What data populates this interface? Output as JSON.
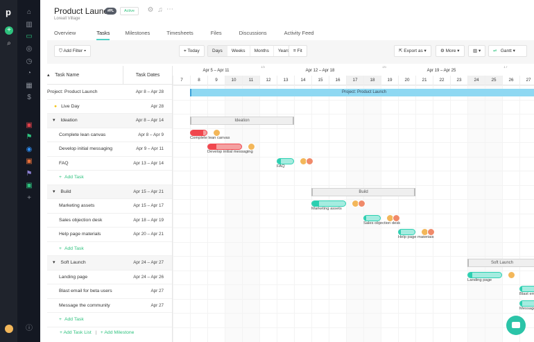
{
  "app": {
    "logo": "p"
  },
  "header": {
    "title": "Product Launch",
    "badge": "#PL",
    "status": "Active",
    "subtitle": "Loreall Village"
  },
  "tabs": [
    "Overview",
    "Tasks",
    "Milestones",
    "Timesheets",
    "Files",
    "Discussions",
    "Activity Feed"
  ],
  "toolbar": {
    "filter": "Add Filter",
    "today": "Today",
    "scales": [
      "Days",
      "Weeks",
      "Months",
      "Years"
    ],
    "fit": "Fit",
    "export": "Export as",
    "more": "More",
    "view": "Gantt"
  },
  "table": {
    "col_name": "Task Name",
    "col_dates": "Task Dates",
    "rows": [
      {
        "name": "Project: Product Launch",
        "dates": "Apr 8 – Apr 28",
        "type": "project"
      },
      {
        "name": "Live Day",
        "dates": "Apr 28",
        "type": "milestone"
      },
      {
        "name": "Ideation",
        "dates": "Apr 8 – Apr 14",
        "type": "group"
      },
      {
        "name": "Complete lean canvas",
        "dates": "Apr 8 – Apr 9",
        "type": "task"
      },
      {
        "name": "Develop initial messaging",
        "dates": "Apr 9 – Apr 11",
        "type": "task"
      },
      {
        "name": "FAQ",
        "dates": "Apr 13 – Apr 14",
        "type": "task"
      },
      {
        "name": "Add Task",
        "dates": "",
        "type": "add"
      },
      {
        "name": "Build",
        "dates": "Apr 15 – Apr 21",
        "type": "group"
      },
      {
        "name": "Marketing assets",
        "dates": "Apr 15 – Apr 17",
        "type": "task"
      },
      {
        "name": "Sales objection desk",
        "dates": "Apr 18 – Apr 19",
        "type": "task"
      },
      {
        "name": "Help page materials",
        "dates": "Apr 20 – Apr 21",
        "type": "task"
      },
      {
        "name": "Add Task",
        "dates": "",
        "type": "add"
      },
      {
        "name": "Soft Launch",
        "dates": "Apr 24 – Apr 27",
        "type": "group"
      },
      {
        "name": "Landing page",
        "dates": "Apr 24 – Apr 26",
        "type": "task"
      },
      {
        "name": "Blast email for beta users",
        "dates": "Apr 27",
        "type": "task"
      },
      {
        "name": "Message the community",
        "dates": "Apr 27",
        "type": "task"
      },
      {
        "name": "Add Task",
        "dates": "",
        "type": "add"
      }
    ],
    "footer": {
      "add_list": "Add Task List",
      "sep": "|",
      "add_milestone": "Add Milestone"
    }
  },
  "timeline": {
    "weeks": [
      {
        "label": "Apr 5 – Apr 11",
        "num": ""
      },
      {
        "label": "Apr 12 – Apr 18",
        "num": "15"
      },
      {
        "label": "Apr 19 – Apr 25",
        "num": "16"
      },
      {
        "label": "",
        "num": "17"
      }
    ],
    "days": [
      7,
      8,
      9,
      10,
      11,
      12,
      13,
      14,
      15,
      16,
      17,
      18,
      19,
      20,
      21,
      22,
      23,
      24,
      25,
      26,
      27
    ],
    "weekends": [
      10,
      11,
      17,
      18,
      24,
      25
    ]
  },
  "bars": [
    {
      "row": 0,
      "start": 8,
      "end": 28,
      "kind": "project",
      "label": "Project: Product Launch"
    },
    {
      "row": 2,
      "start": 8,
      "end": 14,
      "kind": "summary",
      "label": "Ideation"
    },
    {
      "row": 3,
      "start": 8,
      "end": 9,
      "kind": "red",
      "progress": 0.8,
      "label": "Complete lean canvas",
      "avatars": 1
    },
    {
      "row": 4,
      "start": 9,
      "end": 11,
      "kind": "red",
      "progress": 0.25,
      "label": "Develop initial messaging",
      "avatars": 1
    },
    {
      "row": 5,
      "start": 13,
      "end": 14,
      "kind": "teal",
      "progress": 0.2,
      "label": "FAQ",
      "avatars": 2
    },
    {
      "row": 7,
      "start": 15,
      "end": 21,
      "kind": "summary",
      "label": "Build"
    },
    {
      "row": 8,
      "start": 15,
      "end": 17,
      "kind": "teal",
      "progress": 0.2,
      "label": "Marketing assets",
      "avatars": 2
    },
    {
      "row": 9,
      "start": 18,
      "end": 19,
      "kind": "teal",
      "progress": 0,
      "label": "Sales objection desk",
      "avatars": 2
    },
    {
      "row": 10,
      "start": 20,
      "end": 21,
      "kind": "teal",
      "progress": 0,
      "label": "Help page materials",
      "avatars": 2
    },
    {
      "row": 12,
      "start": 24,
      "end": 28,
      "kind": "summary",
      "label": "Soft Launch"
    },
    {
      "row": 13,
      "start": 24,
      "end": 26,
      "kind": "teal",
      "progress": 0,
      "label": "Landing page",
      "avatars": 1
    },
    {
      "row": 14,
      "start": 27,
      "end": 28,
      "kind": "teal",
      "progress": 0,
      "label": "Blast email for beta users",
      "avatars": 0
    },
    {
      "row": 15,
      "start": 27,
      "end": 28,
      "kind": "teal",
      "progress": 0,
      "label": "Message the community",
      "avatars": 0
    }
  ],
  "colors": {
    "red": "#f0474e",
    "red_light": "#f4a1a1",
    "teal": "#2ccfb0",
    "teal_light": "#a5ece0",
    "project": "#8fd8f2",
    "accent": "#2ec27e"
  }
}
